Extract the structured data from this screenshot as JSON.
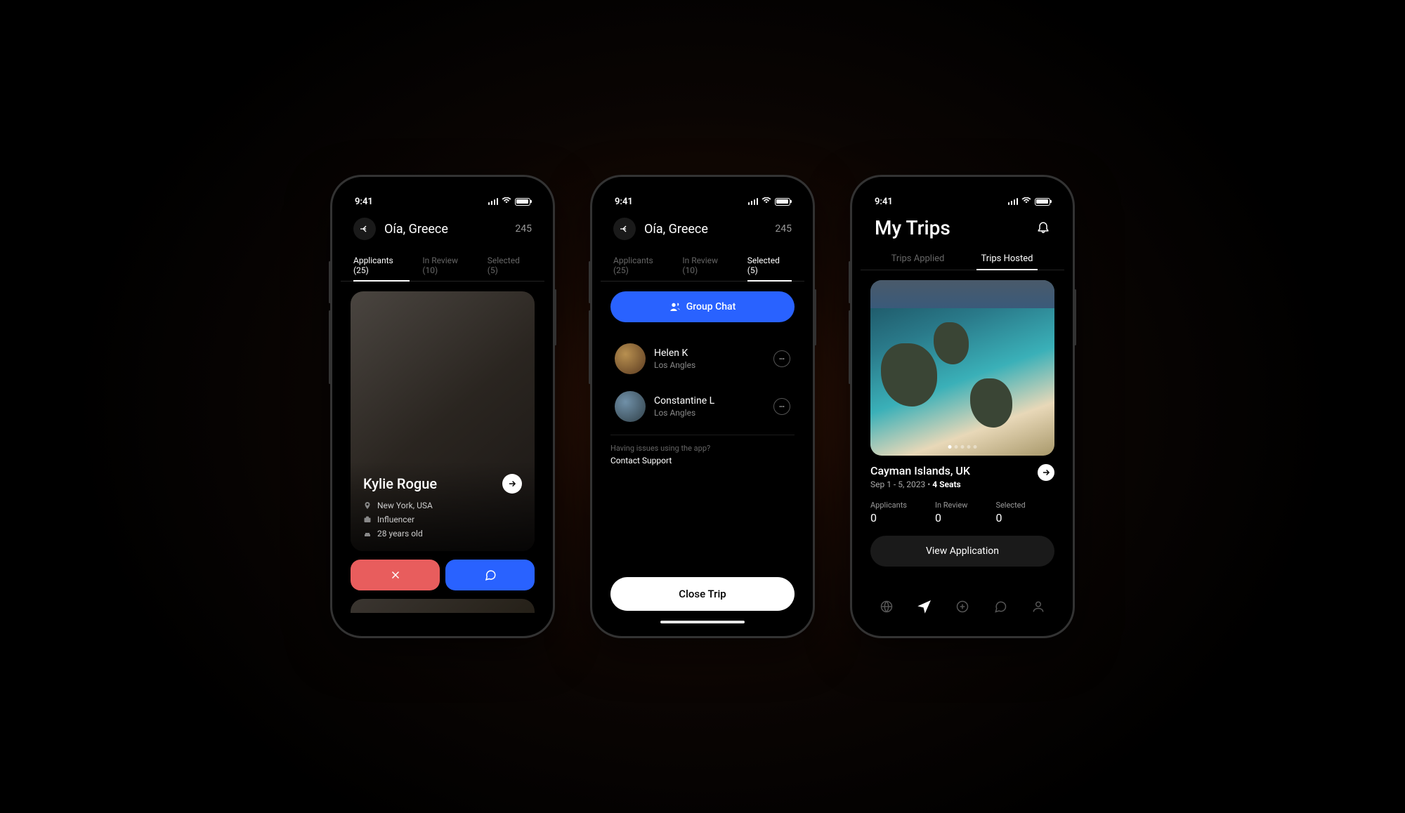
{
  "status": {
    "time": "9:41"
  },
  "screen1": {
    "title": "Oía, Greece",
    "count": "245",
    "tabs": {
      "applicants": "Applicants (25)",
      "review": "In Review (10)",
      "selected": "Selected (5)"
    },
    "applicant": {
      "name": "Kylie Rogue",
      "location": "New York, USA",
      "role": "Influencer",
      "age": "28 years old"
    }
  },
  "screen2": {
    "title": "Oía, Greece",
    "count": "245",
    "tabs": {
      "applicants": "Applicants (25)",
      "review": "In Review (10)",
      "selected": "Selected (5)"
    },
    "groupChat": "Group Chat",
    "members": [
      {
        "name": "Helen K",
        "loc": "Los Angles"
      },
      {
        "name": "Constantine L",
        "loc": "Los Angles"
      }
    ],
    "supportLabel": "Having issues using the app?",
    "supportLink": "Contact Support",
    "close": "Close Trip"
  },
  "screen3": {
    "title": "My Trips",
    "tabs": {
      "applied": "Trips Applied",
      "hosted": "Trips Hosted"
    },
    "trip": {
      "title": "Cayman Islands, UK",
      "dates": "Sep 1 - 5, 2023",
      "seats": "4 Seats",
      "applicants_label": "Applicants",
      "applicants": "0",
      "review_label": "In Review",
      "review": "0",
      "selected_label": "Selected",
      "selected": "0",
      "viewBtn": "View Application"
    }
  }
}
